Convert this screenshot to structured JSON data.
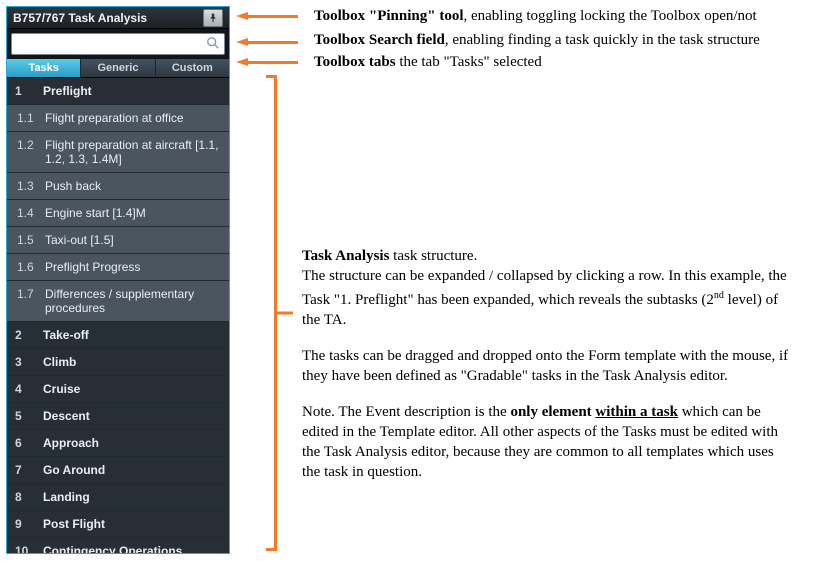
{
  "toolbox": {
    "title": "B757/767 Task Analysis",
    "search": {
      "value": "",
      "placeholder": ""
    },
    "tabs": [
      {
        "label": "Tasks",
        "active": true
      },
      {
        "label": "Generic",
        "active": false
      },
      {
        "label": "Custom",
        "active": false
      }
    ],
    "rows": [
      {
        "type": "top",
        "num": "1",
        "label": "Preflight"
      },
      {
        "type": "sub",
        "num": "1.1",
        "label": "Flight preparation at office"
      },
      {
        "type": "sub",
        "num": "1.2",
        "label": "Flight preparation at aircraft [1.1, 1.2, 1.3, 1.4M]"
      },
      {
        "type": "sub",
        "num": "1.3",
        "label": "Push back"
      },
      {
        "type": "sub",
        "num": "1.4",
        "label": "Engine start [1.4]M"
      },
      {
        "type": "sub",
        "num": "1.5",
        "label": "Taxi-out [1.5]"
      },
      {
        "type": "sub",
        "num": "1.6",
        "label": "Preflight Progress"
      },
      {
        "type": "sub",
        "num": "1.7",
        "label": "Differences / supplementary procedures"
      },
      {
        "type": "top",
        "num": "2",
        "label": "Take-off"
      },
      {
        "type": "top",
        "num": "3",
        "label": "Climb"
      },
      {
        "type": "top",
        "num": "4",
        "label": "Cruise"
      },
      {
        "type": "top",
        "num": "5",
        "label": "Descent"
      },
      {
        "type": "top",
        "num": "6",
        "label": "Approach"
      },
      {
        "type": "top",
        "num": "7",
        "label": "Go Around"
      },
      {
        "type": "top",
        "num": "8",
        "label": "Landing"
      },
      {
        "type": "top",
        "num": "9",
        "label": "Post Flight"
      },
      {
        "type": "top",
        "num": "10",
        "label": "Contingency Operations"
      }
    ]
  },
  "annotations": {
    "a1_bold": "Toolbox \"Pinning\" tool",
    "a1_rest": ", enabling toggling locking the Toolbox open/not",
    "a2_bold": "Toolbox Search field",
    "a2_rest": ", enabling finding a task quickly in the task structure",
    "a3_bold": "Toolbox tabs",
    "a3_rest": " the tab \"Tasks\" selected",
    "a4_bold": "Task Analysis",
    "a4_l1": " task structure.",
    "a4_l2": "The structure can be expanded / collapsed by clicking a row.  In this example, the Task \"1. Preflight\" has been expanded, which reveals the subtasks (2",
    "a4_l2b": " level) of the TA.",
    "a4_p2": "The tasks can be dragged and dropped onto the Form template with the mouse, if they have been defined as \"Gradable\" tasks in the Task Analysis editor.",
    "a4_p3a": "Note. The Event description is the ",
    "a4_p3b": "only element ",
    "a4_p3c": "within a task",
    "a4_p3d": " which can be edited in the Template editor. All other aspects of the Tasks must be edited with the Task Analysis editor, because they are common to all templates which uses the task in question."
  }
}
